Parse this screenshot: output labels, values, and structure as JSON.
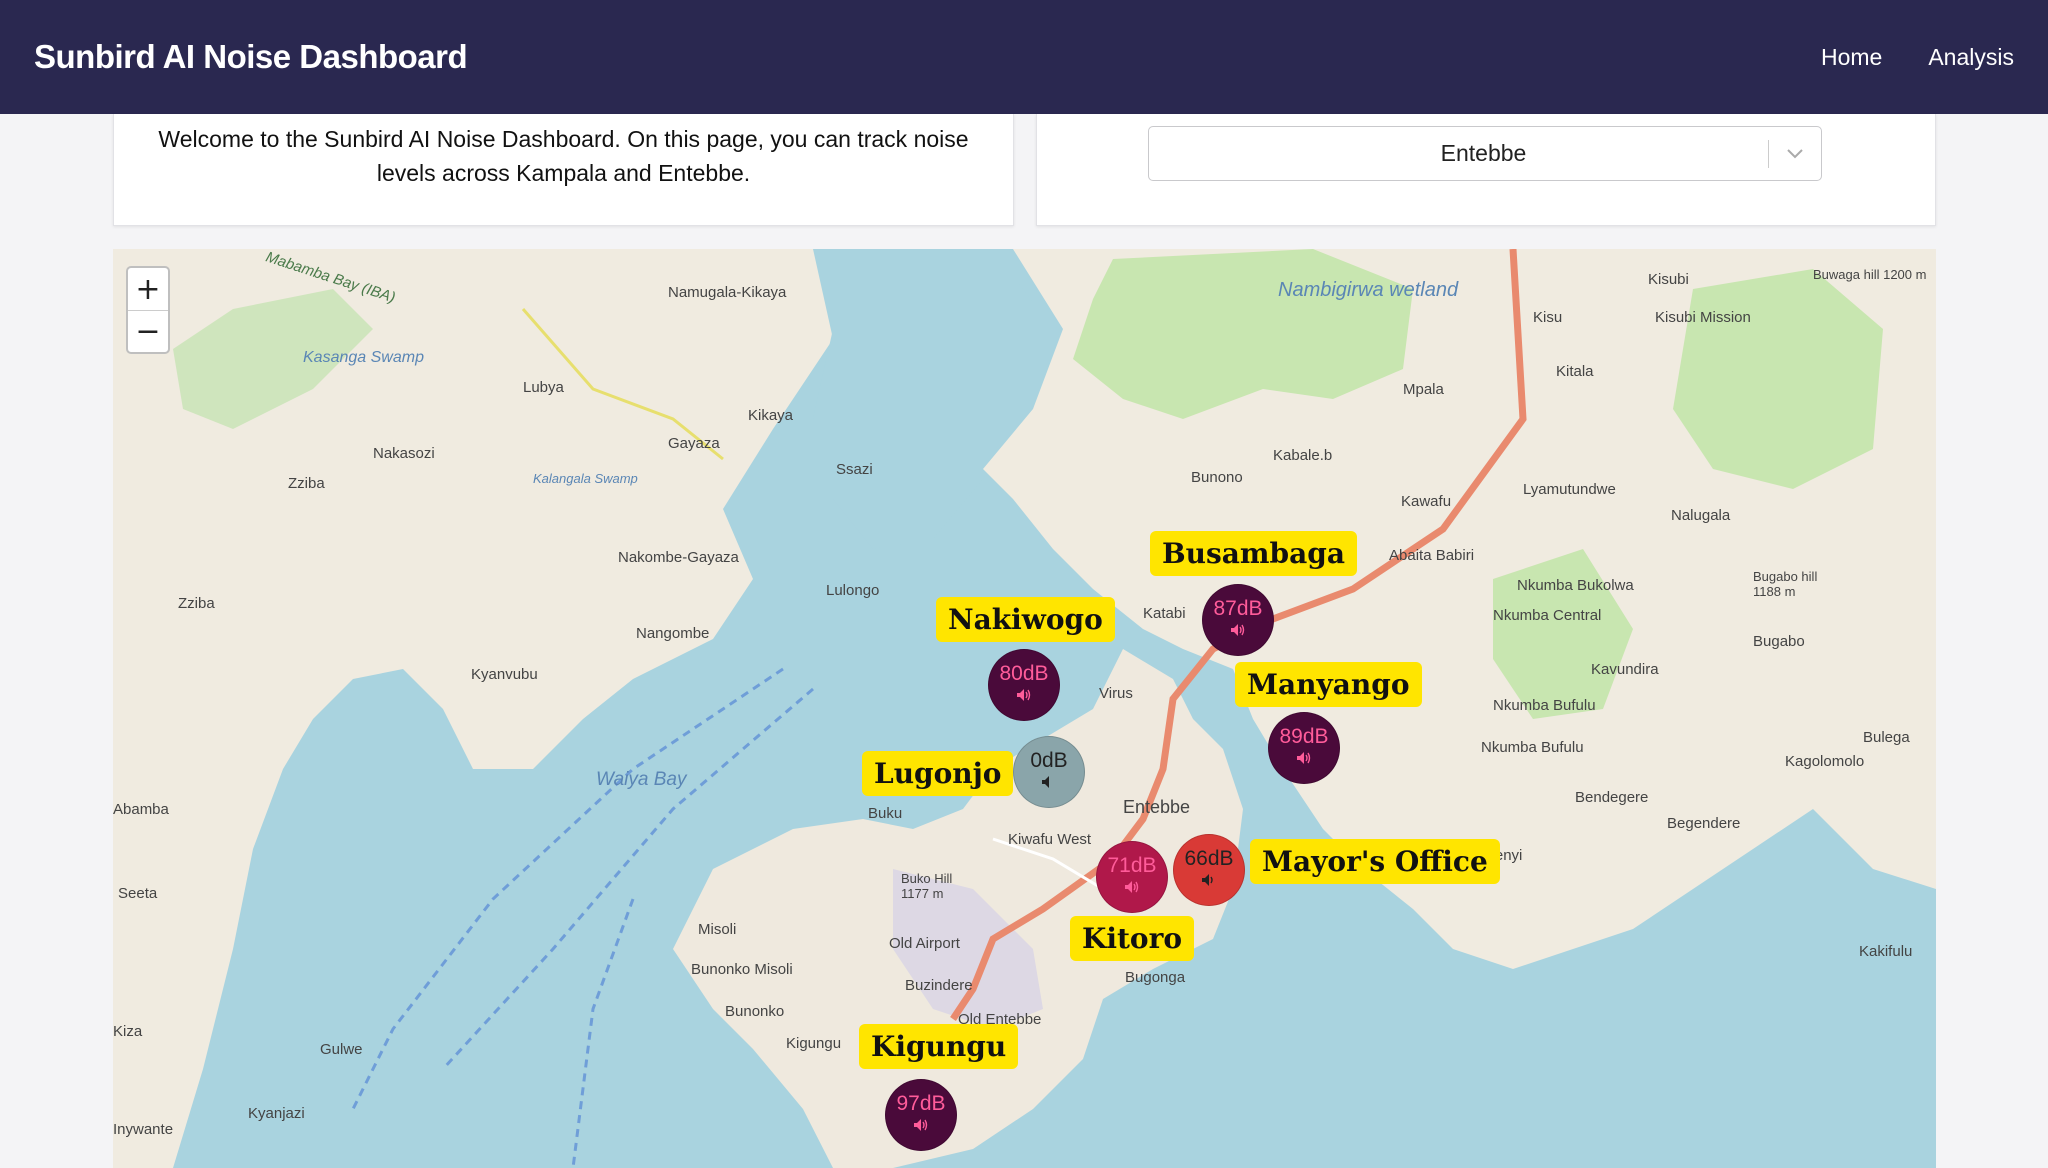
{
  "header": {
    "title": "Sunbird AI Noise Dashboard",
    "nav": [
      "Home",
      "Analysis"
    ]
  },
  "welcome": {
    "text": "Welcome to the Sunbird AI Noise Dashboard. On this page, you can track noise levels across Kampala and Entebbe."
  },
  "location_select": {
    "value": "Entebbe"
  },
  "zoom": {
    "in": "+",
    "out": "−"
  },
  "colors": {
    "header_bg": "#2a2850",
    "label_bg": "#ffe500",
    "marker_high": "#4a0a3a",
    "marker_mid": "#b0184a",
    "marker_low": "#d93a36",
    "marker_zero": "#8aa5aa"
  },
  "locations": [
    {
      "name": "Busambaga",
      "value": "87dB",
      "color": "#4a0a3a",
      "icon": "speaker-icon"
    },
    {
      "name": "Nakiwogo",
      "value": "80dB",
      "color": "#4a0a3a",
      "icon": "speaker-icon"
    },
    {
      "name": "Manyango",
      "value": "89dB",
      "color": "#4a0a3a",
      "icon": "speaker-icon"
    },
    {
      "name": "Lugonjo",
      "value": "0dB",
      "color": "#8aa5aa",
      "icon": "speaker-icon"
    },
    {
      "name": "Mayor's Office",
      "value": "66dB",
      "color": "#d93a36",
      "icon": "speaker-icon"
    },
    {
      "name": "Kitoro",
      "value": "71dB",
      "color": "#b0184a",
      "icon": "speaker-icon"
    },
    {
      "name": "Kigungu",
      "value": "97dB",
      "color": "#4a0a3a",
      "icon": "speaker-icon"
    }
  ],
  "places": [
    "Mabamba Bay (IBA)",
    "Kasanga Swamp",
    "Namugala-Kikaya",
    "Lubya",
    "Nakasozi",
    "Zziba",
    "Kalangala Swamp",
    "Kikaya",
    "Gayaza",
    "Ssazi",
    "Nakombe-Gayaza",
    "Lulongo",
    "Zziba",
    "Nangombe",
    "Kyanvubu",
    "Waiya Bay",
    "Nambigirwa wetland",
    "Kisubi",
    "Buwaga hill 1200 m",
    "Kisu",
    "Kisubi Mission",
    "Mpala",
    "Kitala",
    "Kabale.b",
    "Bunono",
    "Lyamutundwe",
    "Kawafu",
    "Nalugala",
    "Abaita Babiri",
    "Nkumba Bukolwa",
    "Nkumba Central",
    "Bugabo hill 1188 m",
    "Bugabo",
    "Katabi",
    "Kavundira",
    "Nkumba Bufulu",
    "Nkumba Bufulu",
    "Bulega",
    "Kagolomolo",
    "Bendegere",
    "Begendere",
    "Kasenyi",
    "Kakifulu",
    "Virus",
    "Kiwafu West",
    "Entebbe",
    "Buku",
    "Buko Hill 1177 m",
    "Old Airport",
    "Misoli",
    "Bunonko Misoli",
    "Buzindere",
    "Bunonko",
    "Bugonga",
    "Old Entebbe",
    "Kigungu",
    "Kyanjazi",
    "Gulwe",
    "Seeta",
    "Abamba",
    "Kiza",
    "Inywante"
  ]
}
